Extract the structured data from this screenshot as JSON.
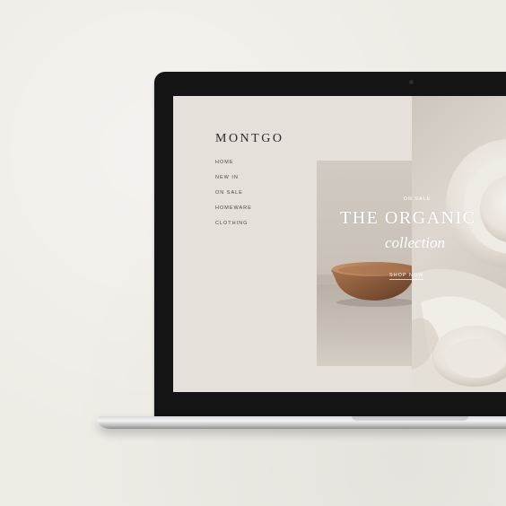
{
  "site": {
    "brand": "MONTGO",
    "nav": [
      "HOME",
      "NEW IN",
      "ON SALE",
      "HOMEWARE",
      "CLOTHING"
    ]
  },
  "hero": {
    "eyebrow": "ON SALE",
    "title": "THE ORGANIC",
    "subtitle": "collection",
    "cta": "SHOP NOW"
  },
  "colors": {
    "page_background": "#efece6",
    "screen_background": "#e5e1da",
    "bezel": "#141414",
    "brand_text": "#2b2926",
    "hero_text": "#ffffff",
    "bowl_wood": "#8a5a3c"
  },
  "icons": {
    "camera": "webcam-dot"
  }
}
